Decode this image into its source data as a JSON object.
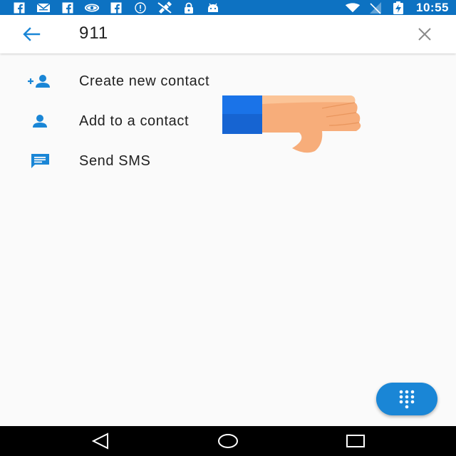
{
  "status_bar": {
    "left_icons": [
      "facebook-icon",
      "mail-icon",
      "facebook-icon",
      "eye-icon",
      "facebook-icon",
      "info-icon",
      "no-signal-satellite-icon",
      "lock-icon",
      "android-icon"
    ],
    "right_icons": [
      "wifi-icon",
      "no-sim-icon",
      "battery-charging-icon"
    ],
    "time": "10:55",
    "color": "#0d72c2"
  },
  "search": {
    "query": "911",
    "back_icon": "arrow-back-icon",
    "clear_icon": "close-icon"
  },
  "actions": [
    {
      "icon": "add-contact-icon",
      "label": "Create new contact"
    },
    {
      "icon": "person-icon",
      "label": "Add to a contact"
    },
    {
      "icon": "message-icon",
      "label": "Send SMS"
    }
  ],
  "overlay": {
    "icon": "thumbs-down-icon"
  },
  "fab": {
    "icon": "dialpad-icon",
    "color": "#1a86d6"
  },
  "nav": {
    "back_icon": "nav-back-icon",
    "home_icon": "nav-home-icon",
    "recents_icon": "nav-recents-icon"
  },
  "accent": "#1a86d6"
}
